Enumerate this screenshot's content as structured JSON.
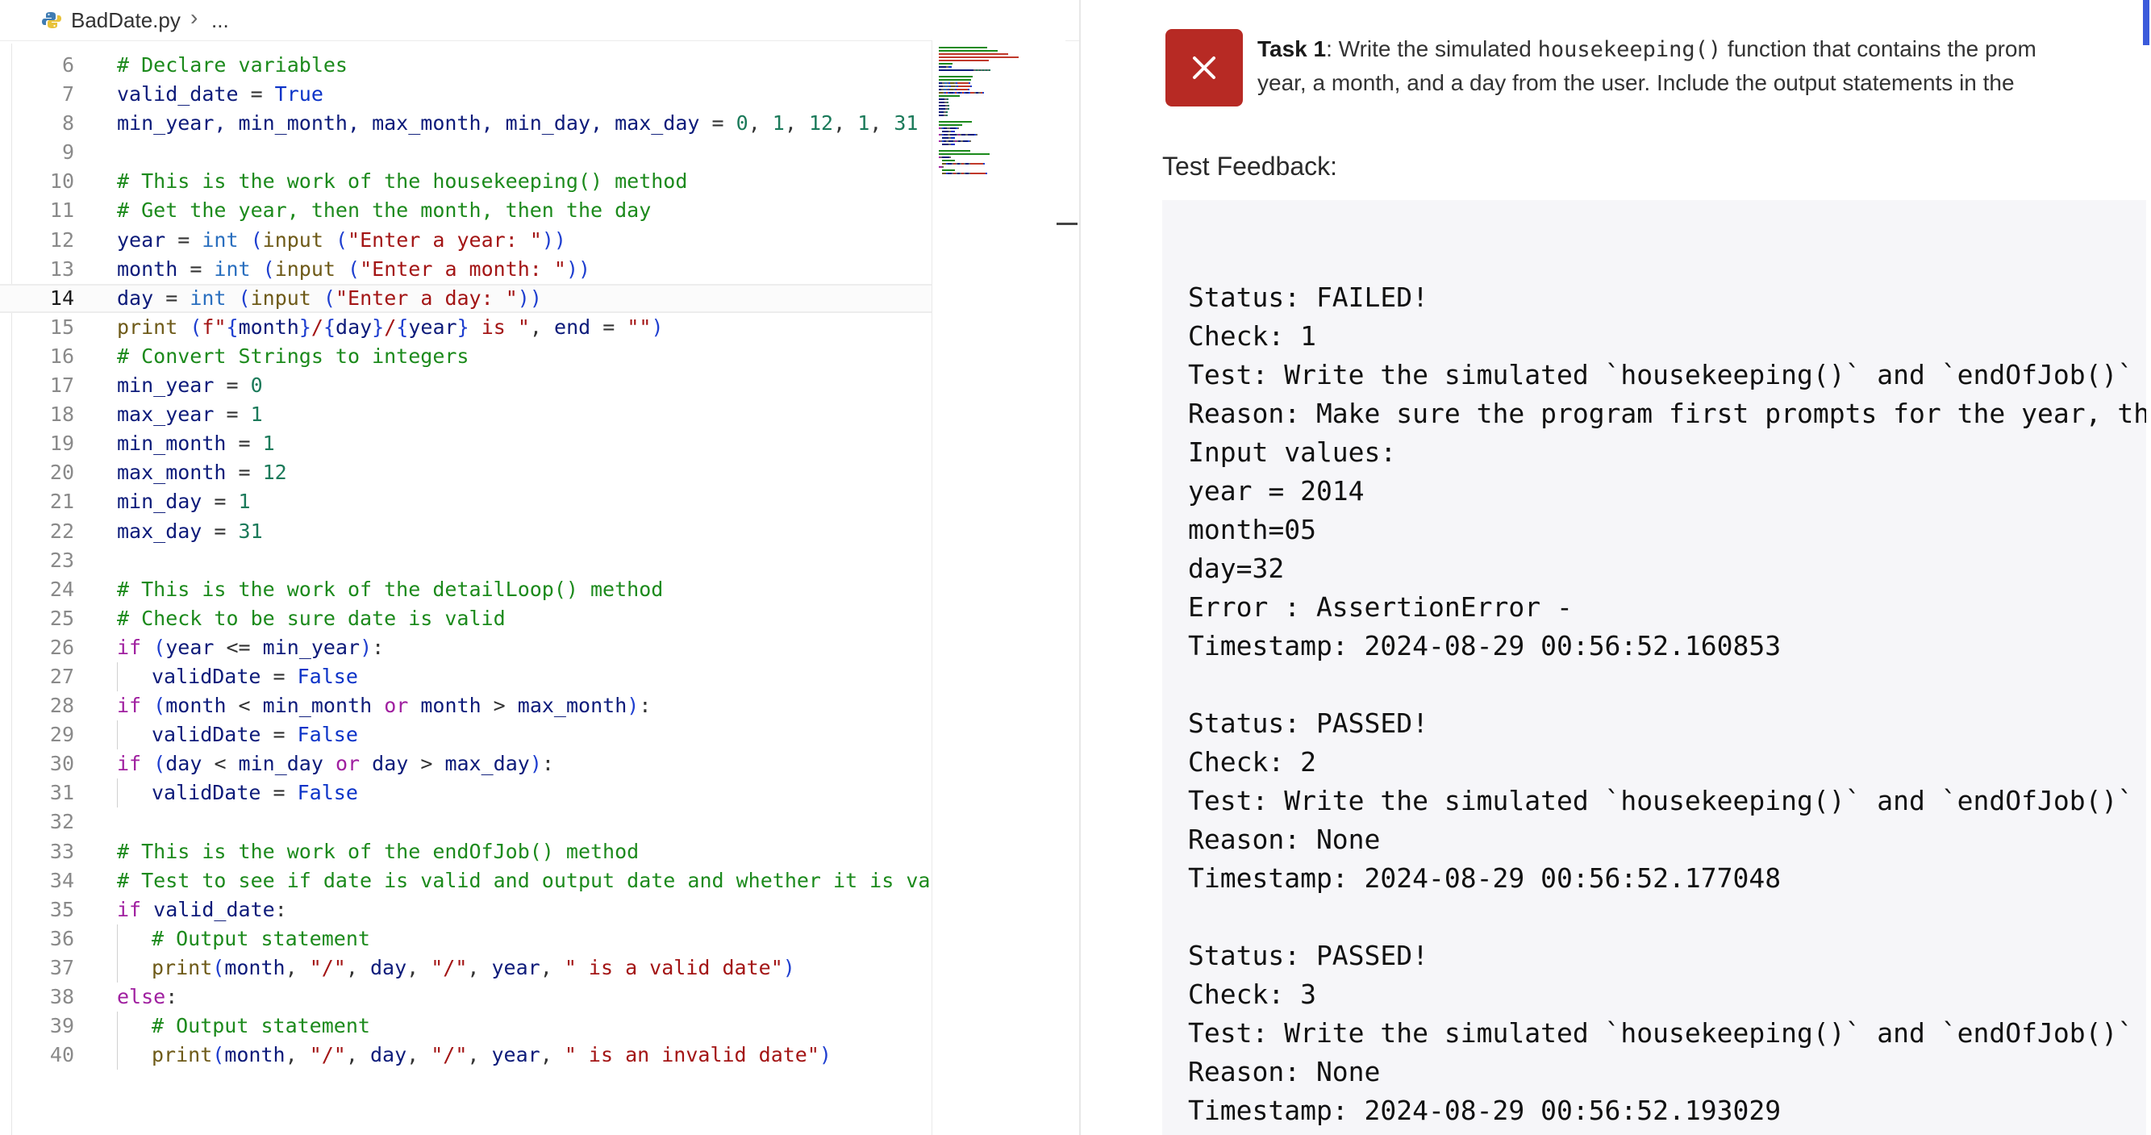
{
  "editor": {
    "breadcrumb": {
      "file_name": "BadDate.py",
      "separator": "›",
      "ellipsis": "..."
    },
    "current_line": "14",
    "lines": [
      {
        "n": "6",
        "segs": [
          [
            "com",
            "# Declare variables"
          ]
        ]
      },
      {
        "n": "7",
        "segs": [
          [
            "var",
            "valid_date"
          ],
          [
            "op",
            " = "
          ],
          [
            "bool",
            "True"
          ]
        ]
      },
      {
        "n": "8",
        "segs": [
          [
            "var",
            "min_year, min_month, max_month, min_day, max_day"
          ],
          [
            "op",
            " = "
          ],
          [
            "num",
            "0"
          ],
          [
            "op",
            ", "
          ],
          [
            "num",
            "1"
          ],
          [
            "op",
            ", "
          ],
          [
            "num",
            "12"
          ],
          [
            "op",
            ", "
          ],
          [
            "num",
            "1"
          ],
          [
            "op",
            ", "
          ],
          [
            "num",
            "31"
          ]
        ]
      },
      {
        "n": "9",
        "segs": []
      },
      {
        "n": "10",
        "segs": [
          [
            "com",
            "# This is the work of the housekeeping() method"
          ]
        ]
      },
      {
        "n": "11",
        "segs": [
          [
            "com",
            "# Get the year, then the month, then the day"
          ]
        ]
      },
      {
        "n": "12",
        "segs": [
          [
            "var",
            "year"
          ],
          [
            "op",
            " = "
          ],
          [
            "bi",
            "int"
          ],
          [
            "op",
            " "
          ],
          [
            "p",
            "("
          ],
          [
            "fn",
            "input"
          ],
          [
            "op",
            " "
          ],
          [
            "p",
            "("
          ],
          [
            "str",
            "\"Enter a year: \""
          ],
          [
            "p",
            "))"
          ]
        ]
      },
      {
        "n": "13",
        "segs": [
          [
            "var",
            "month"
          ],
          [
            "op",
            " = "
          ],
          [
            "bi",
            "int"
          ],
          [
            "op",
            " "
          ],
          [
            "p",
            "("
          ],
          [
            "fn",
            "input"
          ],
          [
            "op",
            " "
          ],
          [
            "p",
            "("
          ],
          [
            "str",
            "\"Enter a month: \""
          ],
          [
            "p",
            "))"
          ]
        ]
      },
      {
        "n": "14",
        "segs": [
          [
            "var",
            "day"
          ],
          [
            "op",
            " = "
          ],
          [
            "bi",
            "int"
          ],
          [
            "op",
            " "
          ],
          [
            "p",
            "("
          ],
          [
            "fn",
            "input"
          ],
          [
            "op",
            " "
          ],
          [
            "p",
            "("
          ],
          [
            "str",
            "\"Enter a day: \""
          ],
          [
            "p",
            "))"
          ]
        ]
      },
      {
        "n": "15",
        "segs": [
          [
            "fn",
            "print"
          ],
          [
            "op",
            " "
          ],
          [
            "p",
            "("
          ],
          [
            "str",
            "f\""
          ],
          [
            "p",
            "{"
          ],
          [
            "var",
            "month"
          ],
          [
            "p",
            "}"
          ],
          [
            "str",
            "/"
          ],
          [
            "p",
            "{"
          ],
          [
            "var",
            "day"
          ],
          [
            "p",
            "}"
          ],
          [
            "str",
            "/"
          ],
          [
            "p",
            "{"
          ],
          [
            "var",
            "year"
          ],
          [
            "p",
            "}"
          ],
          [
            "str",
            " is \""
          ],
          [
            "op",
            ", "
          ],
          [
            "var",
            "end"
          ],
          [
            "op",
            " = "
          ],
          [
            "str",
            "\"\""
          ],
          [
            "p",
            ")"
          ]
        ]
      },
      {
        "n": "16",
        "segs": [
          [
            "com",
            "# Convert Strings to integers"
          ]
        ]
      },
      {
        "n": "17",
        "segs": [
          [
            "var",
            "min_year"
          ],
          [
            "op",
            " = "
          ],
          [
            "num",
            "0"
          ]
        ]
      },
      {
        "n": "18",
        "segs": [
          [
            "var",
            "max_year"
          ],
          [
            "op",
            " = "
          ],
          [
            "num",
            "1"
          ]
        ]
      },
      {
        "n": "19",
        "segs": [
          [
            "var",
            "min_month"
          ],
          [
            "op",
            " = "
          ],
          [
            "num",
            "1"
          ]
        ]
      },
      {
        "n": "20",
        "segs": [
          [
            "var",
            "max_month"
          ],
          [
            "op",
            " = "
          ],
          [
            "num",
            "12"
          ]
        ]
      },
      {
        "n": "21",
        "segs": [
          [
            "var",
            "min_day"
          ],
          [
            "op",
            " = "
          ],
          [
            "num",
            "1"
          ]
        ]
      },
      {
        "n": "22",
        "segs": [
          [
            "var",
            "max_day"
          ],
          [
            "op",
            " = "
          ],
          [
            "num",
            "31"
          ]
        ]
      },
      {
        "n": "23",
        "segs": []
      },
      {
        "n": "24",
        "segs": [
          [
            "com",
            "# This is the work of the detailLoop() method"
          ]
        ]
      },
      {
        "n": "25",
        "segs": [
          [
            "com",
            "# Check to be sure date is valid"
          ]
        ]
      },
      {
        "n": "26",
        "segs": [
          [
            "kw",
            "if"
          ],
          [
            "op",
            " "
          ],
          [
            "p",
            "("
          ],
          [
            "var",
            "year"
          ],
          [
            "op",
            " <= "
          ],
          [
            "var",
            "min_year"
          ],
          [
            "p",
            ")"
          ],
          [
            "op",
            ":"
          ]
        ]
      },
      {
        "n": "27",
        "ind": true,
        "segs": [
          [
            "var",
            "validDate"
          ],
          [
            "op",
            " = "
          ],
          [
            "bool",
            "False"
          ]
        ]
      },
      {
        "n": "28",
        "segs": [
          [
            "kw",
            "if"
          ],
          [
            "op",
            " "
          ],
          [
            "p",
            "("
          ],
          [
            "var",
            "month"
          ],
          [
            "op",
            " < "
          ],
          [
            "var",
            "min_month"
          ],
          [
            "op",
            " "
          ],
          [
            "kw",
            "or"
          ],
          [
            "op",
            " "
          ],
          [
            "var",
            "month"
          ],
          [
            "op",
            " > "
          ],
          [
            "var",
            "max_month"
          ],
          [
            "p",
            ")"
          ],
          [
            "op",
            ":"
          ]
        ]
      },
      {
        "n": "29",
        "ind": true,
        "segs": [
          [
            "var",
            "validDate"
          ],
          [
            "op",
            " = "
          ],
          [
            "bool",
            "False"
          ]
        ]
      },
      {
        "n": "30",
        "segs": [
          [
            "kw",
            "if"
          ],
          [
            "op",
            " "
          ],
          [
            "p",
            "("
          ],
          [
            "var",
            "day"
          ],
          [
            "op",
            " < "
          ],
          [
            "var",
            "min_day"
          ],
          [
            "op",
            " "
          ],
          [
            "kw",
            "or"
          ],
          [
            "op",
            " "
          ],
          [
            "var",
            "day"
          ],
          [
            "op",
            " > "
          ],
          [
            "var",
            "max_day"
          ],
          [
            "p",
            ")"
          ],
          [
            "op",
            ":"
          ]
        ]
      },
      {
        "n": "31",
        "ind": true,
        "segs": [
          [
            "var",
            "validDate"
          ],
          [
            "op",
            " = "
          ],
          [
            "bool",
            "False"
          ]
        ]
      },
      {
        "n": "32",
        "segs": []
      },
      {
        "n": "33",
        "segs": [
          [
            "com",
            "# This is the work of the endOfJob() method"
          ]
        ]
      },
      {
        "n": "34",
        "segs": [
          [
            "com",
            "# Test to see if date is valid and output date and whether it is valic"
          ]
        ]
      },
      {
        "n": "35",
        "segs": [
          [
            "kw",
            "if"
          ],
          [
            "op",
            " "
          ],
          [
            "var",
            "valid_date"
          ],
          [
            "op",
            ":"
          ]
        ]
      },
      {
        "n": "36",
        "ind": true,
        "segs": [
          [
            "com",
            "# Output statement"
          ]
        ]
      },
      {
        "n": "37",
        "ind": true,
        "segs": [
          [
            "fn",
            "print"
          ],
          [
            "p",
            "("
          ],
          [
            "var",
            "month"
          ],
          [
            "op",
            ", "
          ],
          [
            "str",
            "\"/\""
          ],
          [
            "op",
            ", "
          ],
          [
            "var",
            "day"
          ],
          [
            "op",
            ", "
          ],
          [
            "str",
            "\"/\""
          ],
          [
            "op",
            ", "
          ],
          [
            "var",
            "year"
          ],
          [
            "op",
            ", "
          ],
          [
            "str",
            "\" is a valid date\""
          ],
          [
            "p",
            ")"
          ]
        ]
      },
      {
        "n": "38",
        "segs": [
          [
            "kw",
            "else"
          ],
          [
            "op",
            ":"
          ]
        ]
      },
      {
        "n": "39",
        "ind": true,
        "segs": [
          [
            "com",
            "# Output statement"
          ]
        ]
      },
      {
        "n": "40",
        "ind": true,
        "segs": [
          [
            "fn",
            "print"
          ],
          [
            "p",
            "("
          ],
          [
            "var",
            "month"
          ],
          [
            "op",
            ", "
          ],
          [
            "str",
            "\"/\""
          ],
          [
            "op",
            ", "
          ],
          [
            "var",
            "day"
          ],
          [
            "op",
            ", "
          ],
          [
            "str",
            "\"/\""
          ],
          [
            "op",
            ", "
          ],
          [
            "var",
            "year"
          ],
          [
            "op",
            ", "
          ],
          [
            "str",
            "\" is an invalid date\""
          ],
          [
            "p",
            ")"
          ]
        ]
      }
    ]
  },
  "task": {
    "label": "Task 1",
    "line1_before": ": Write the simulated ",
    "line1_code": "housekeeping()",
    "line1_after": " function that contains the prom",
    "line2": "year, a month, and a day from the user. Include the output statements in the"
  },
  "feedback": {
    "heading": "Test Feedback:",
    "lines": [
      "Status: FAILED!",
      "Check: 1",
      "Test: Write the simulated `housekeeping()` and `endOfJob()` f",
      "Reason: Make sure the program first prompts for the year, tha",
      "Input values:",
      "year = 2014",
      "month=05",
      "day=32",
      "Error : AssertionError -",
      "Timestamp: 2024-08-29 00:56:52.160853",
      "",
      "Status: PASSED!",
      "Check: 2",
      "Test: Write the simulated `housekeeping()` and `endOfJob()` f",
      "Reason: None",
      "Timestamp: 2024-08-29 00:56:52.177048",
      "",
      "Status: PASSED!",
      "Check: 3",
      "Test: Write the simulated `housekeeping()` and `endOfJob()` f",
      "Reason: None",
      "Timestamp: 2024-08-29 00:56:52.193029"
    ]
  },
  "colors": {
    "fail_red": "#b72a24",
    "accent_blue": "#3b5bdb",
    "comment_green": "#1c8a1c",
    "string_red": "#a31515",
    "keyword_purple": "#a020a0"
  },
  "icons": {
    "file_icon": "python-file-icon",
    "status_icon": "close-x-icon"
  }
}
